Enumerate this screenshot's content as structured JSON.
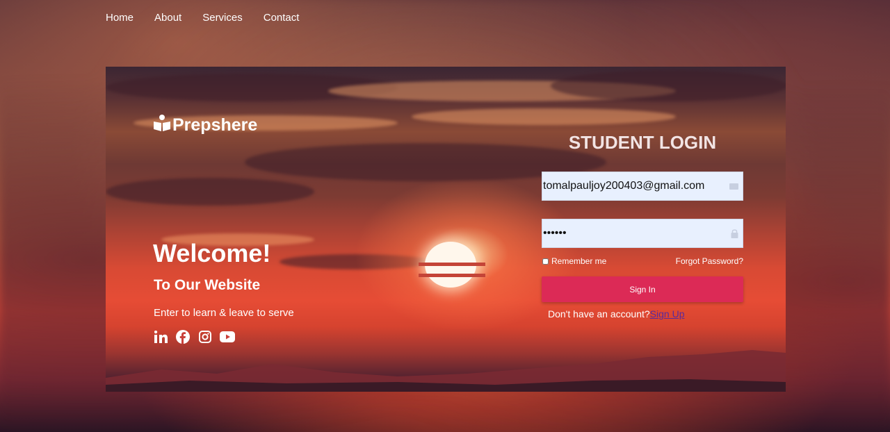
{
  "nav": {
    "items": [
      {
        "label": "Home"
      },
      {
        "label": "About"
      },
      {
        "label": "Services"
      },
      {
        "label": "Contact"
      }
    ]
  },
  "brand": {
    "name": "Prepshere",
    "icon": "reader-book-icon"
  },
  "hero": {
    "title": "Welcome!",
    "subtitle": "To Our Website",
    "tagline": "Enter to learn & leave to serve",
    "socials": [
      "linkedin-icon",
      "facebook-icon",
      "instagram-icon",
      "youtube-icon"
    ]
  },
  "login": {
    "title": "STUDENT LOGIN",
    "email_value": "tomalpauljoy200403@gmail.com",
    "password_value": "••••••",
    "remember_label": "Remember me",
    "remember_checked": false,
    "forgot_label": "Forgot Password?",
    "signin_label": "Sign In",
    "no_account_text": "Don't have an account?",
    "signup_label": "Sign Up"
  },
  "colors": {
    "accent": "#dc2a56",
    "link": "#5a2a9c",
    "field_bg": "#e8f0fe"
  }
}
